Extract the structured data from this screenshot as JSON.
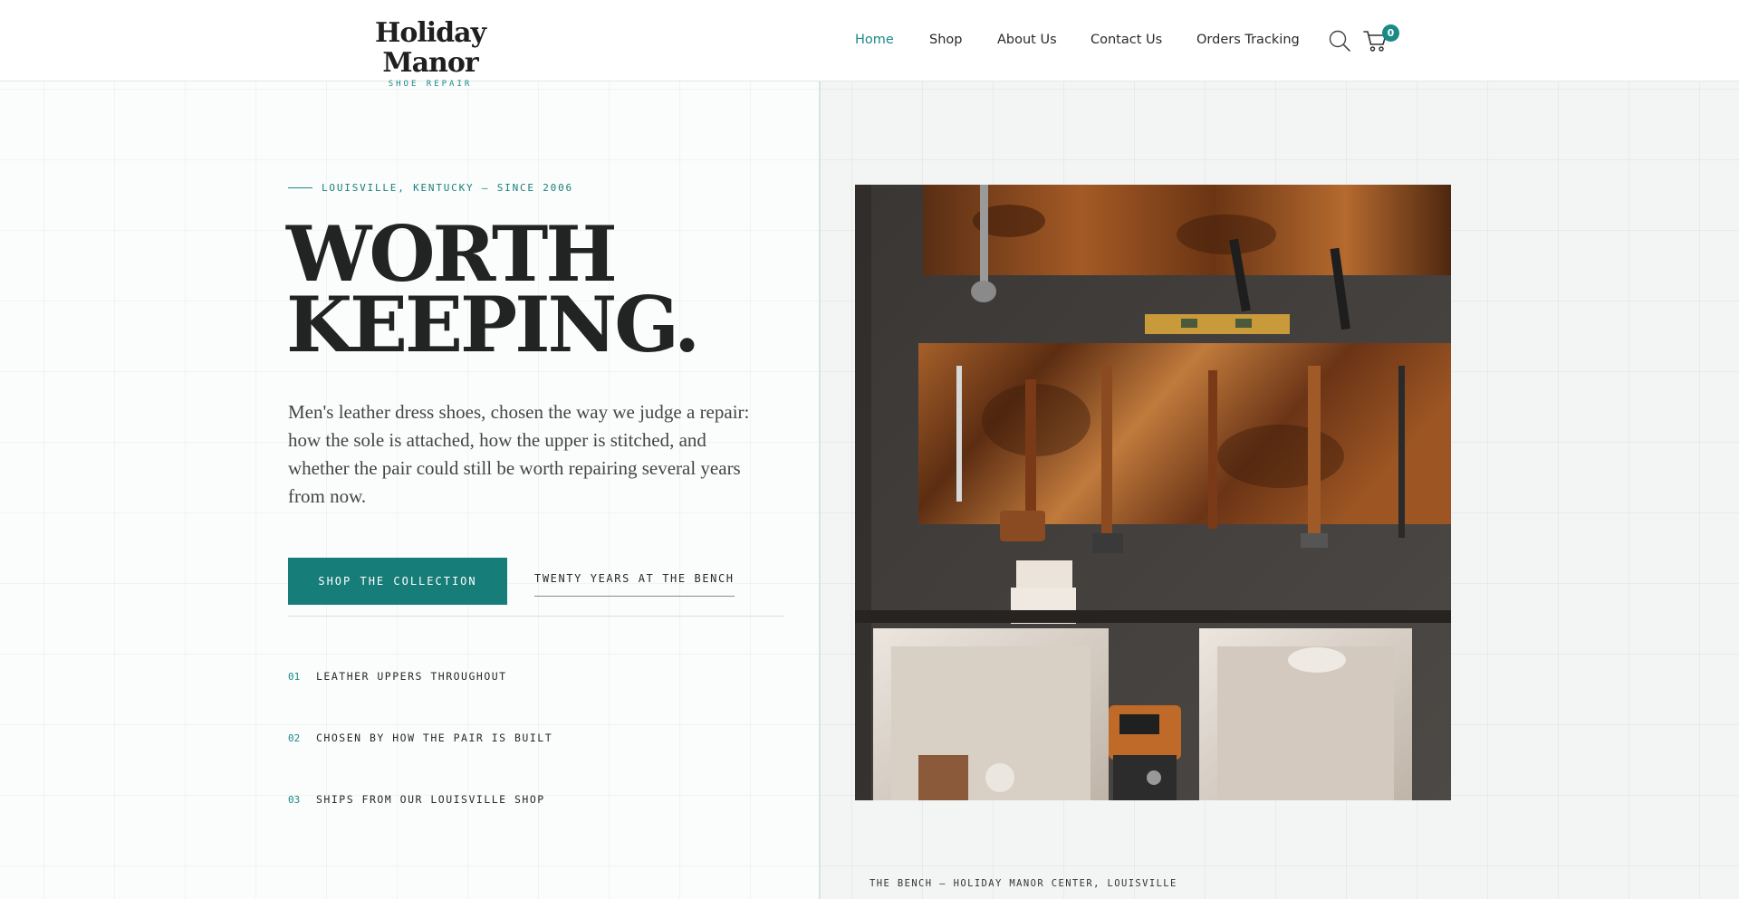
{
  "brand": {
    "name": "Holiday Manor",
    "tagline": "SHOE REPAIR"
  },
  "nav": {
    "items": [
      {
        "label": "Home",
        "active": true
      },
      {
        "label": "Shop"
      },
      {
        "label": "About Us"
      },
      {
        "label": "Contact Us"
      },
      {
        "label": "Orders Tracking"
      }
    ],
    "search_icon": "search-icon",
    "cart_icon": "cart-icon",
    "cart_count": "0"
  },
  "hero": {
    "eyebrow": "LOUISVILLE, KENTUCKY — SINCE 2006",
    "headline_line1": "WORTH",
    "headline_line2": "KEEPING.",
    "lead": "Men's leather dress shoes, chosen the way we judge a repair: how the sole is attached, how the upper is stitched, and whether the pair could still be worth repairing several years from now.",
    "primary_cta": "SHOP THE COLLECTION",
    "secondary_cta": "TWENTY YEARS AT THE BENCH",
    "features": [
      {
        "num": "01",
        "text": "LEATHER UPPERS THROUGHOUT"
      },
      {
        "num": "02",
        "text": "CHOSEN BY HOW THE PAIR IS BUILT"
      },
      {
        "num": "03",
        "text": "SHIPS FROM OUR LOUISVILLE SHOP"
      }
    ]
  },
  "photo": {
    "caption": "THE BENCH — HOLIDAY MANOR CENTER, LOUISVILLE"
  },
  "colors": {
    "accent": "#1a8a86",
    "button": "#167d79",
    "text": "#232323"
  }
}
